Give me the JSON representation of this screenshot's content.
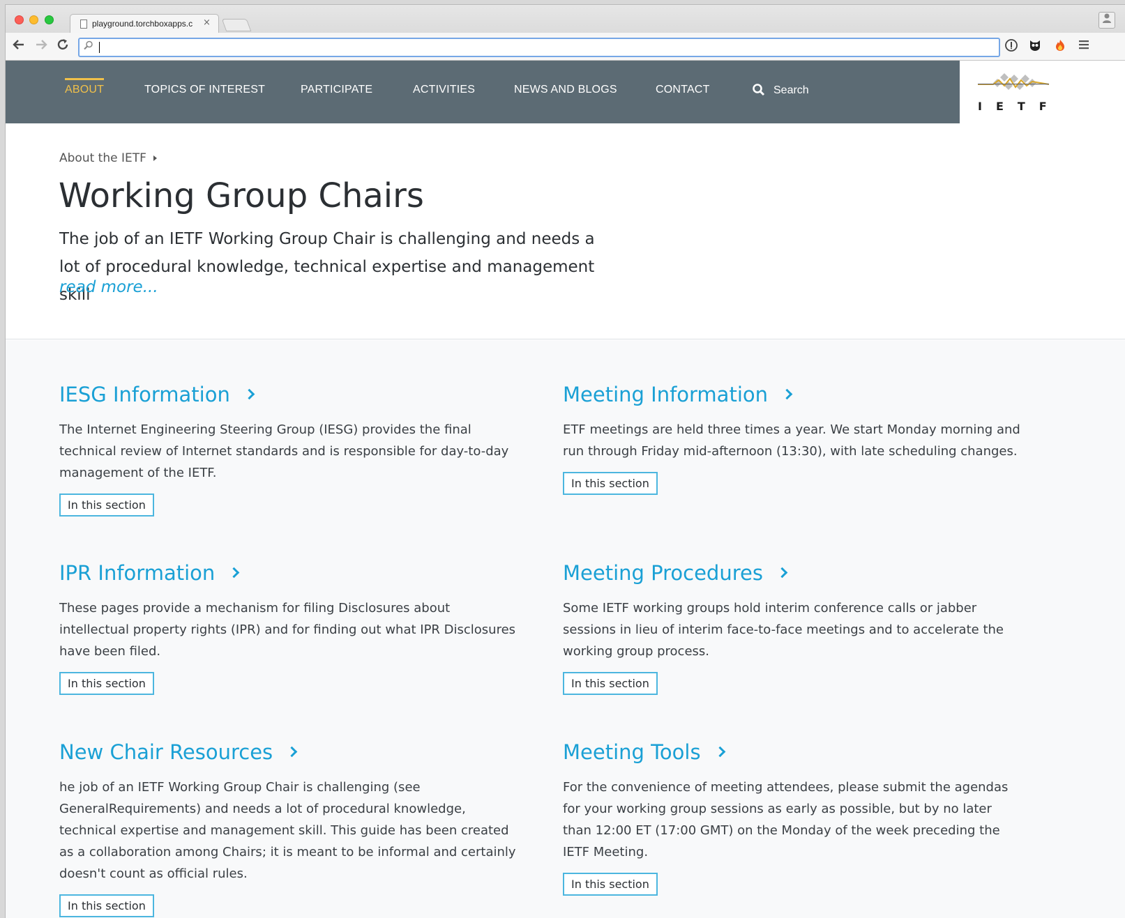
{
  "browser": {
    "tab_title": "playground.torchboxapps.c",
    "close_glyph": "×",
    "address_value": ""
  },
  "nav": {
    "items": [
      "ABOUT",
      "TOPICS OF INTEREST",
      "PARTICIPATE",
      "ACTIVITIES",
      "NEWS AND BLOGS",
      "CONTACT"
    ],
    "active": "ABOUT",
    "search_label": "Search"
  },
  "logo": {
    "text": "IETF"
  },
  "hero": {
    "breadcrumb": "About the IETF",
    "title": "Working Group Chairs",
    "intro": "The job of an IETF Working Group Chair is challenging and needs a lot of procedural knowledge, technical expertise and management skill",
    "read_more": "read more..."
  },
  "sections": [
    {
      "title": "IESG Information",
      "description": "The Internet Engineering Steering Group (IESG) provides the final technical review of Internet standards and is responsible for day-to-day management of the IETF.",
      "button": "In this section"
    },
    {
      "title": "Meeting Information",
      "description": "ETF meetings are held three times a year. We start Monday morning and run through Friday mid-afternoon (13:30), with late scheduling changes.",
      "button": "In this section"
    },
    {
      "title": "IPR Information",
      "description": "These pages provide a mechanism for filing Disclosures about intellectual property rights (IPR) and for finding out what IPR Disclosures have been filed.",
      "button": "In this section"
    },
    {
      "title": "Meeting Procedures",
      "description": "Some IETF working groups hold interim conference calls or jabber sessions in lieu of interim face-to-face meetings and to accelerate the working group process.",
      "button": "In this section"
    },
    {
      "title": "New Chair Resources",
      "description": "he job of an IETF Working Group Chair is challenging (see GeneralRequirements) and needs a lot of procedural knowledge, technical expertise and management skill. This guide has been created as a collaboration among Chairs; it is meant to be informal and certainly doesn't count as official rules.",
      "button": "In this section"
    },
    {
      "title": "Meeting Tools",
      "description": "For the convenience of meeting attendees, please submit the agendas for your working group sessions as early as possible, but by no later than 12:00 ET (17:00 GMT) on the Monday of the week preceding the IETF Meeting.",
      "button": "In this section"
    }
  ],
  "colors": {
    "nav_bg": "#5c6b74",
    "accent": "#1aa0d5",
    "active_nav": "#f0c04a"
  }
}
